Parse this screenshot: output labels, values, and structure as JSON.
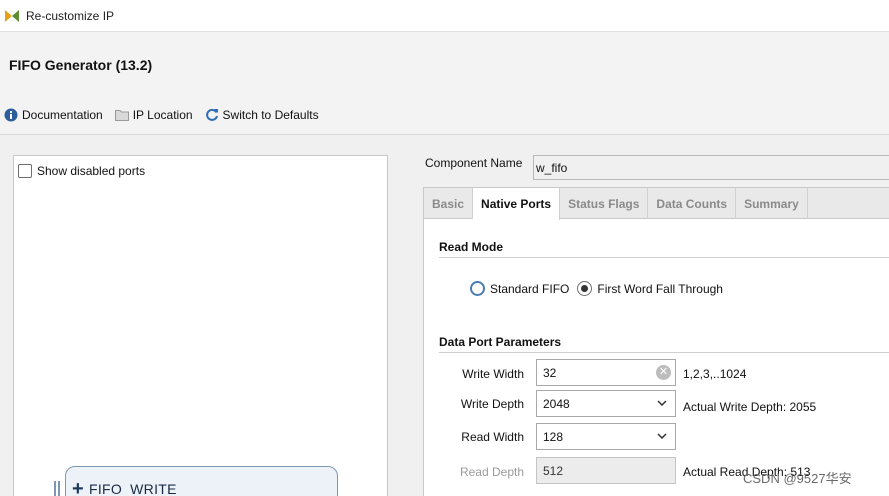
{
  "window": {
    "title": "Re-customize IP"
  },
  "header": {
    "ip_title": "FIFO Generator (13.2)",
    "toolbar": {
      "documentation": "Documentation",
      "ip_location": "IP Location",
      "switch_defaults": "Switch to Defaults"
    }
  },
  "left_panel": {
    "show_disabled_ports": "Show disabled ports",
    "block_label": "FIFO_WRITE"
  },
  "component": {
    "label": "Component Name",
    "value": "w_fifo"
  },
  "tabs": [
    {
      "label": "Basic",
      "active": false
    },
    {
      "label": "Native Ports",
      "active": true
    },
    {
      "label": "Status Flags",
      "active": false
    },
    {
      "label": "Data Counts",
      "active": false
    },
    {
      "label": "Summary",
      "active": false
    }
  ],
  "read_mode": {
    "title": "Read Mode",
    "options": [
      {
        "label": "Standard FIFO",
        "selected": false
      },
      {
        "label": "First Word Fall Through",
        "selected": true
      }
    ]
  },
  "data_port": {
    "title": "Data Port Parameters",
    "write_width": {
      "label": "Write Width",
      "value": "32",
      "hint": "1,2,3,..1024"
    },
    "write_depth": {
      "label": "Write Depth",
      "value": "2048",
      "hint": "Actual Write Depth: 2055"
    },
    "read_width": {
      "label": "Read Width",
      "value": "128"
    },
    "read_depth": {
      "label": "Read Depth",
      "value": "512",
      "hint": "Actual Read Depth: 513"
    }
  },
  "watermark": "CSDN @9527华安",
  "colors": {
    "accent": "#4a7bb3",
    "info_icon": "#2d5e9c",
    "switch_icon": "#2f6db5"
  }
}
